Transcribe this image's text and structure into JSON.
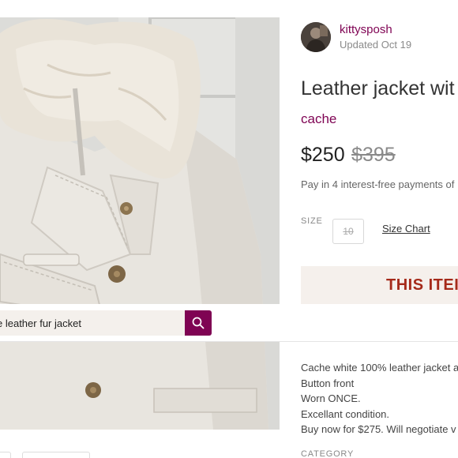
{
  "seller": {
    "username": "kittysposh",
    "updated": "Updated Oct 19",
    "avatar_icon": "avatar-photo"
  },
  "listing": {
    "title": "Leather jacket wit",
    "brand": "cache",
    "price": "$250",
    "original_price": "$395",
    "installments": "Pay in 4 interest-free payments of",
    "size_label": "SIZE",
    "size_value": "10",
    "size_chart_link": "Size Chart",
    "sold_banner": "THIS ITEI",
    "description_lines": [
      "Cache white 100% leather jacket a",
      "Button front",
      "Worn ONCE.",
      "Excellant condition.",
      "Buy now for $275. Will negotiate v"
    ],
    "category_label": "CATEGORY"
  },
  "search": {
    "value": "e leather fur jacket",
    "button_icon": "search-icon"
  },
  "colors": {
    "brand_accent": "#7f0353",
    "sold_text": "#a52a1a",
    "sold_bg": "#f5f0ec",
    "search_bg": "#f4f0ec"
  }
}
